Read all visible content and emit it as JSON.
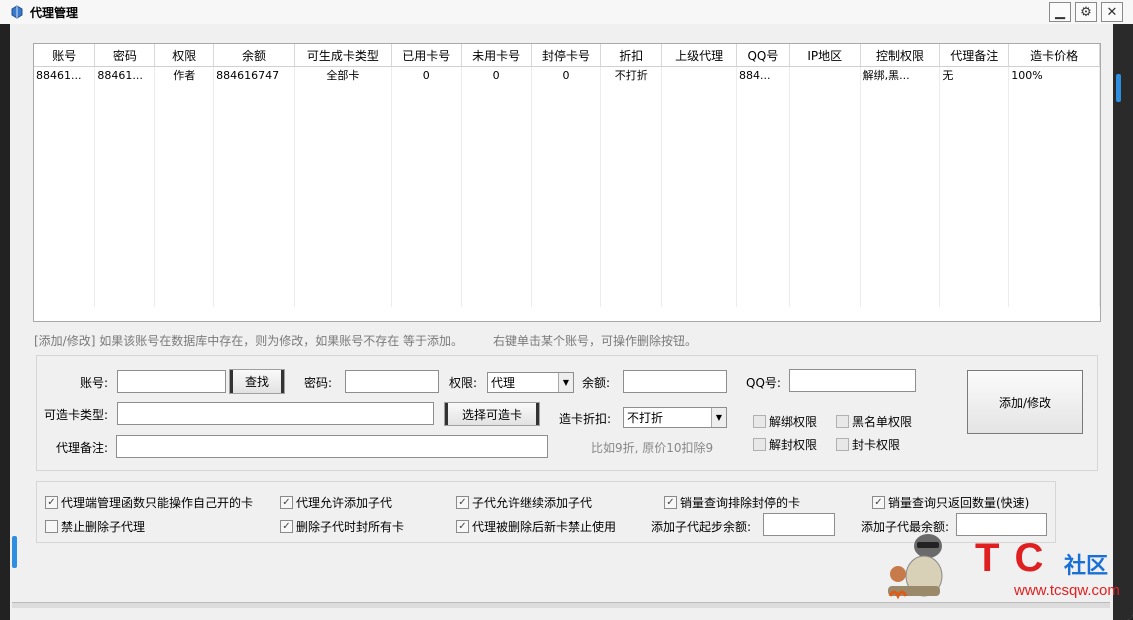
{
  "window": {
    "title": "代理管理"
  },
  "table": {
    "columns": [
      "账号",
      "密码",
      "权限",
      "余额",
      "可生成卡类型",
      "已用卡号",
      "未用卡号",
      "封停卡号",
      "折扣",
      "上级代理",
      "QQ号",
      "IP地区",
      "控制权限",
      "代理备注",
      "造卡价格"
    ],
    "rows": [
      [
        "88461...",
        "88461...",
        "作者",
        "884616747",
        "全部卡",
        "0",
        "0",
        "0",
        "不打折",
        "",
        "884...",
        "",
        "解绑,黑...",
        "无",
        "100%"
      ]
    ]
  },
  "hint": {
    "left": "[添加/修改]  如果该账号在数据库中存在，则为修改，如果账号不存在 等于添加。",
    "right": "右键单击某个账号，可操作删除按钮。"
  },
  "form": {
    "account_label": "账号:",
    "account_value": "",
    "find_button": "查找",
    "password_label": "密码:",
    "password_value": "",
    "permission_label": "权限:",
    "permission_value": "代理",
    "balance_label": "余额:",
    "balance_value": "",
    "qq_label": "QQ号:",
    "qq_value": "",
    "card_type_label": "可造卡类型:",
    "card_type_value": "",
    "select_card_button": "选择可造卡",
    "discount_label": "造卡折扣:",
    "discount_value": "不打折",
    "remark_label": "代理备注:",
    "remark_value": "",
    "discount_hint": "比如9折, 原价10扣除9",
    "perm_unbind": "解绑权限",
    "perm_blacklist": "黑名单权限",
    "perm_unban": "解封权限",
    "perm_ban_card": "封卡权限",
    "submit_button": "添加/修改"
  },
  "options": {
    "opt1": "代理端管理函数只能操作自己开的卡",
    "opt2": "代理允许添加子代",
    "opt3": "子代允许继续添加子代",
    "opt4": "销量查询排除封停的卡",
    "opt5": "销量查询只返回数量(快速)",
    "opt6": "禁止删除子代理",
    "opt7": "删除子代时封所有卡",
    "opt8": "代理被删除后新卡禁止使用",
    "min_balance_label": "添加子代起步余额:",
    "min_balance_value": "",
    "max_balance_label": "添加子代最余额:",
    "max_balance_value": "",
    "checked": {
      "opt1": true,
      "opt2": true,
      "opt3": true,
      "opt4": true,
      "opt5": true,
      "opt6": false,
      "opt7": true,
      "opt8": true
    }
  },
  "watermark": {
    "brand": "T C",
    "community": "社区",
    "site": "www.tcsqw.com"
  },
  "colors": {
    "accent": "#2e8fe0",
    "brand_red": "#e02020",
    "brand_blue": "#1a6fd6"
  }
}
